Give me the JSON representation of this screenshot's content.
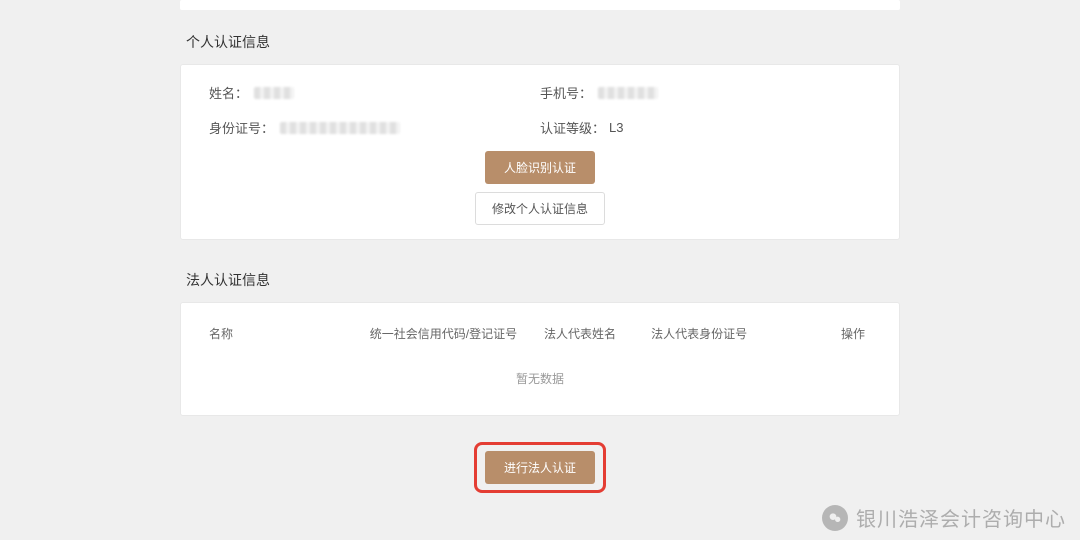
{
  "personal": {
    "title": "个人认证信息",
    "name_label": "姓名：",
    "phone_label": "手机号：",
    "id_label": "身份证号：",
    "level_label": "认证等级：",
    "level_value": "L3",
    "face_btn": "人脸识别认证",
    "modify_btn": "修改个人认证信息"
  },
  "legal": {
    "title": "法人认证信息",
    "columns": {
      "name": "名称",
      "credit_code": "统一社会信用代码/登记证号",
      "rep_name": "法人代表姓名",
      "rep_id": "法人代表身份证号",
      "op": "操作"
    },
    "empty": "暂无数据",
    "auth_btn": "进行法人认证"
  },
  "watermark": {
    "text": "银川浩泽会计咨询中心"
  }
}
